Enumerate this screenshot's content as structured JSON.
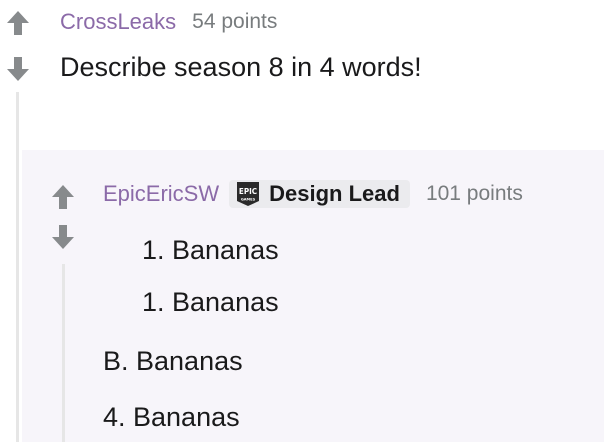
{
  "parent_comment": {
    "author": "CrossLeaks",
    "points": "54 points",
    "body": "Describe season 8 in 4 words!"
  },
  "child_comment": {
    "author": "EpicEricSW",
    "flair": {
      "logo_text_top": "EPIC",
      "logo_text_bottom": "GAMES",
      "label": "Design Lead"
    },
    "points": "101 points",
    "lines": [
      "1. Bananas",
      "1. Bananas",
      "B. Bananas",
      "4. Bananas"
    ]
  },
  "icons": {
    "upvote": "arrow-up-icon",
    "downvote": "arrow-down-icon",
    "flair_logo": "epic-games-logo-icon"
  },
  "colors": {
    "author": "#8b6aa8",
    "points": "#787c7e",
    "vote_arrow": "#878a8c",
    "child_background": "#f7f5fa",
    "flair_background": "#ebebee"
  }
}
